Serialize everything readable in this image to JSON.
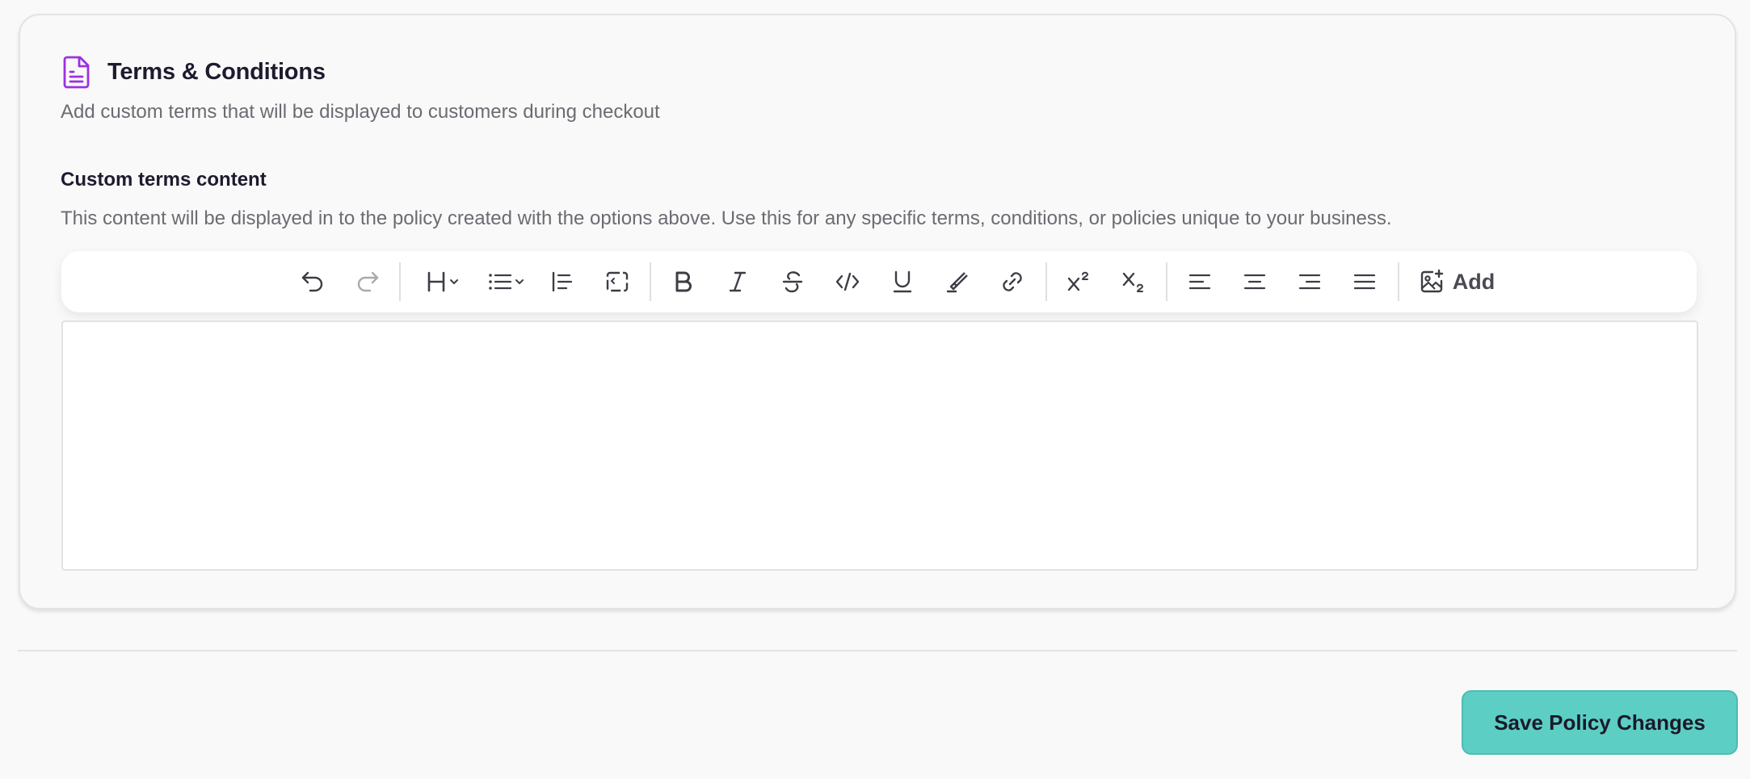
{
  "card": {
    "title": "Terms & Conditions",
    "subtitle": "Add custom terms that will be displayed to customers during checkout",
    "title_icon": "document-icon",
    "accent_color": "#9b30e0"
  },
  "custom_terms": {
    "label": "Custom terms content",
    "help_text": "This content will be displayed in to the policy created with the options above. Use this for any specific terms, conditions, or policies unique to your business.",
    "editor_value": ""
  },
  "toolbar": {
    "buttons": [
      {
        "icon": "undo-icon"
      },
      {
        "icon": "redo-icon",
        "disabled": true
      },
      {
        "icon": "heading-dropdown-icon"
      },
      {
        "icon": "list-dropdown-icon"
      },
      {
        "icon": "blockquote-icon"
      },
      {
        "icon": "code-block-icon"
      },
      {
        "icon": "bold-icon"
      },
      {
        "icon": "italic-icon"
      },
      {
        "icon": "strikethrough-icon"
      },
      {
        "icon": "code-icon"
      },
      {
        "icon": "underline-icon"
      },
      {
        "icon": "highlight-icon"
      },
      {
        "icon": "link-icon"
      },
      {
        "icon": "superscript-icon"
      },
      {
        "icon": "subscript-icon"
      },
      {
        "icon": "align-left-icon"
      },
      {
        "icon": "align-center-icon"
      },
      {
        "icon": "align-right-icon"
      },
      {
        "icon": "align-justify-icon"
      },
      {
        "icon": "add-image-icon"
      }
    ],
    "add_label": "Add"
  },
  "footer": {
    "save_label": "Save Policy Changes",
    "save_color": "#5dcec4"
  }
}
